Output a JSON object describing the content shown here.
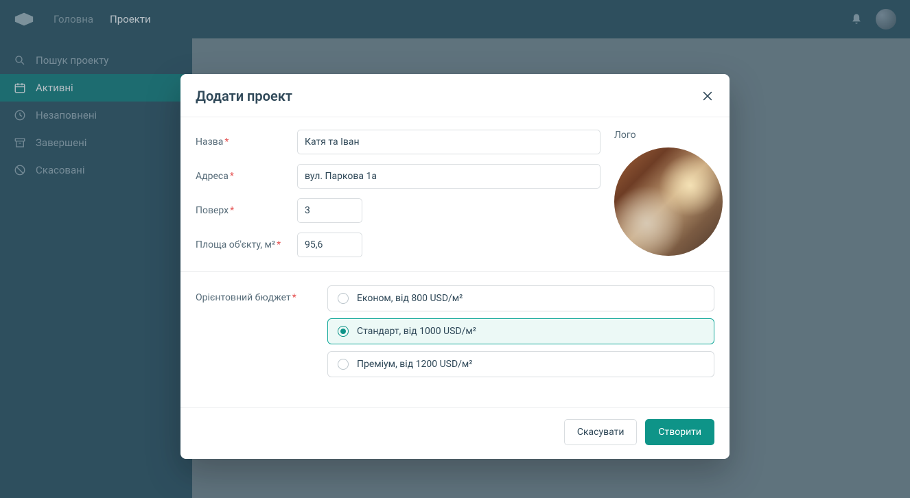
{
  "header": {
    "nav": {
      "home": "Головна",
      "projects": "Проекти"
    }
  },
  "sidebar": {
    "items": [
      {
        "label": "Пошук проекту"
      },
      {
        "label": "Активні"
      },
      {
        "label": "Незаповнені"
      },
      {
        "label": "Завершені"
      },
      {
        "label": "Скасовані"
      }
    ]
  },
  "modal": {
    "title": "Додати проект",
    "labels": {
      "name": "Назва",
      "address": "Адреса",
      "floor": "Поверх",
      "area": "Площа об'єкту, м²",
      "logo": "Лого",
      "budget": "Орієнтовний бюджет"
    },
    "values": {
      "name": "Катя та Іван",
      "address": "вул. Паркова 1а",
      "floor": "3",
      "area": "95,6"
    },
    "budget_options": [
      {
        "label": "Економ, від 800 USD/м²",
        "selected": false
      },
      {
        "label": "Стандарт, від 1000 USD/м²",
        "selected": true
      },
      {
        "label": "Преміум, від 1200 USD/м²",
        "selected": false
      }
    ],
    "buttons": {
      "cancel": "Скасувати",
      "create": "Створити"
    }
  }
}
